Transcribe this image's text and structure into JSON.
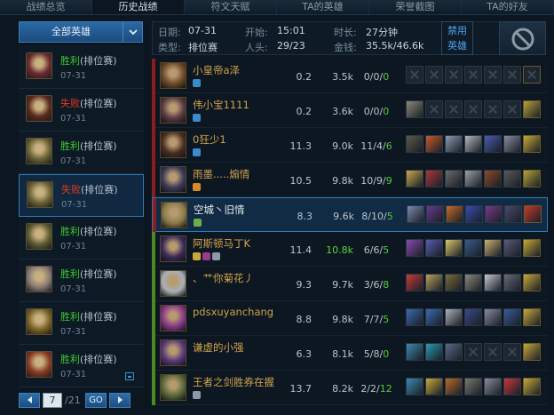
{
  "tabs": [
    {
      "label": "战绩总览",
      "active": false
    },
    {
      "label": "历史战绩",
      "active": true
    },
    {
      "label": "符文天赋",
      "active": false
    },
    {
      "label": "TA的英雄",
      "active": false
    },
    {
      "label": "荣誉截图",
      "active": false
    },
    {
      "label": "TA的好友",
      "active": false
    }
  ],
  "filter": {
    "label": "全部英雄"
  },
  "games": [
    {
      "result": "胜利",
      "mode": "(排位赛)",
      "date": "07-31",
      "win": true,
      "color": "#6b2a30"
    },
    {
      "result": "失败",
      "mode": "(排位赛)",
      "date": "07-31",
      "win": false,
      "color": "#5a2a1e"
    },
    {
      "result": "胜利",
      "mode": "(排位赛)",
      "date": "07-31",
      "win": true,
      "color": "#6a6236"
    },
    {
      "result": "失败",
      "mode": "(排位赛)",
      "date": "07-31",
      "win": false,
      "color": "#6a6236"
    },
    {
      "result": "胜利",
      "mode": "(排位赛)",
      "date": "07-31",
      "win": true,
      "color": "#5e5a33"
    },
    {
      "result": "胜利",
      "mode": "(排位赛)",
      "date": "07-31",
      "win": true,
      "color": "#8a7a74"
    },
    {
      "result": "胜利",
      "mode": "(排位赛)",
      "date": "07-31",
      "win": true,
      "color": "#7a6224"
    },
    {
      "result": "胜利",
      "mode": "(排位赛)",
      "date": "07-31",
      "win": true,
      "color": "#8a3a24"
    }
  ],
  "pager": {
    "current": "7",
    "total": "/21",
    "go": "GO"
  },
  "info": {
    "date_label": "日期:",
    "date": "07-31",
    "start_label": "开始:",
    "start": "15:01",
    "duration_label": "时长:",
    "duration": "27分钟",
    "type_label": "类型:",
    "type": "排位赛",
    "heads_label": "人头:",
    "heads": "29/23",
    "gold_label": "金钱:",
    "gold": "35.5k/46.6k"
  },
  "ban": {
    "line1": "禁用",
    "line2": "英雄"
  },
  "players": [
    {
      "name": "小皇帝a泽",
      "s1": "0.2",
      "s2": "3.5k",
      "k": "0",
      "d": "0",
      "a": "0",
      "team": "#8a1d1d",
      "portrait": "#6e4a2a",
      "badges": [
        "#3a8bc8"
      ],
      "items": [
        "e",
        "e",
        "e",
        "e",
        "e",
        "e",
        "e"
      ]
    },
    {
      "name": "伟小宝1111",
      "s1": "0.2",
      "s2": "3.6k",
      "k": "0",
      "d": "0",
      "a": "0",
      "team": "#8a1d1d",
      "portrait": "#5a3a44",
      "badges": [
        "#3a8bc8"
      ],
      "items": [
        "#8a8a7a",
        "e",
        "e",
        "e",
        "e",
        "e",
        "#b8a23a"
      ]
    },
    {
      "name": "0狂少1",
      "s1": "11.3",
      "s2": "9.0k",
      "k": "11",
      "d": "4",
      "a": "6",
      "team": "#8a1d1d",
      "portrait": "#4a2e22",
      "badges": [
        "#3a8bc8"
      ],
      "items": [
        "#5a5a4a",
        "#c85a2a",
        "#8a9ab0",
        "#b0b8c0",
        "#4a5ab0",
        "#8a8aa0",
        "#c8a83a"
      ]
    },
    {
      "name": "雨墨.....煽情",
      "s1": "10.5",
      "s2": "9.8k",
      "k": "10",
      "d": "9",
      "a": "9",
      "team": "#8a1d1d",
      "portrait": "#3a3a5a",
      "badges": [
        "#d88a2a"
      ],
      "items": [
        "#c8a84a",
        "#a83a3a",
        "#6a6a6a",
        "#9aa0a8",
        "#8a4a2a",
        "#5a5a5a",
        "#b8a23a"
      ]
    },
    {
      "name": "空城丶旧情",
      "s1": "8.3",
      "s2": "9.6k",
      "k": "8",
      "d": "10",
      "a": "5",
      "team": "#8a1d1d",
      "portrait": "#8a7a4a",
      "badges": [
        "#6ab04a"
      ],
      "items": [
        "#7a8ab0",
        "#6a3a8a",
        "#c86a2a",
        "#3a4ab0",
        "#7a3a8a",
        "#4a4a6a",
        "#c83a2a"
      ],
      "me": true
    },
    {
      "name": "阿斯顿马丁K",
      "s1": "11.4",
      "s2": "10.8k",
      "k": "6",
      "d": "6",
      "a": "5",
      "team": "#4a8a1e",
      "portrait": "#3a2a5a",
      "badges": [
        "#c8a83a",
        "#9a3a8a",
        "#8a9aa8"
      ],
      "items": [
        "#8a4ab0",
        "#5a5ab0",
        "#d8c86a",
        "#3a5a8a",
        "#c8b070",
        "#5a5a7a",
        "#c8a83a"
      ],
      "hi": true
    },
    {
      "name": "、艹你菊花丿",
      "s1": "9.3",
      "s2": "9.7k",
      "k": "3",
      "d": "6",
      "a": "8",
      "team": "#4a8a1e",
      "portrait": "#a8b0b8",
      "badges": [],
      "items": [
        "#c83a3a",
        "#b8a05a",
        "#7a6a3a",
        "#8a8a7a",
        "#c8c8d0",
        "#6a6a7a",
        "#c8a83a"
      ]
    },
    {
      "name": "pdsxuyanchang",
      "s1": "8.8",
      "s2": "9.8k",
      "k": "7",
      "d": "7",
      "a": "5",
      "team": "#4a8a1e",
      "portrait": "#8a3a8a",
      "badges": [],
      "items": [
        "#3a6ab0",
        "#3a6ab0",
        "#b0b0b8",
        "#3a4a8a",
        "#8a8aa0",
        "#3a5a9a",
        "#c8a83a"
      ]
    },
    {
      "name": "谦虚的小强",
      "s1": "6.3",
      "s2": "8.1k",
      "k": "5",
      "d": "8",
      "a": "0",
      "team": "#4a8a1e",
      "portrait": "#5a3a7a",
      "badges": [],
      "items": [
        "#3a8ab0",
        "#2a9ab0",
        "#5a6a8a",
        "e",
        "e",
        "e",
        "#c8a83a"
      ]
    },
    {
      "name": "王者之剑胜券在握",
      "s1": "13.7",
      "s2": "8.2k",
      "k": "2",
      "d": "2",
      "a": "12",
      "team": "#4a8a1e",
      "portrait": "#5a6a3a",
      "badges": [
        "#8a9aa8"
      ],
      "items": [
        "#3a8ab0",
        "#c8a83a",
        "#b86a2a",
        "#7a7a6a",
        "#8a8a9a",
        "#c83a3a",
        "#c8a83a"
      ]
    }
  ]
}
